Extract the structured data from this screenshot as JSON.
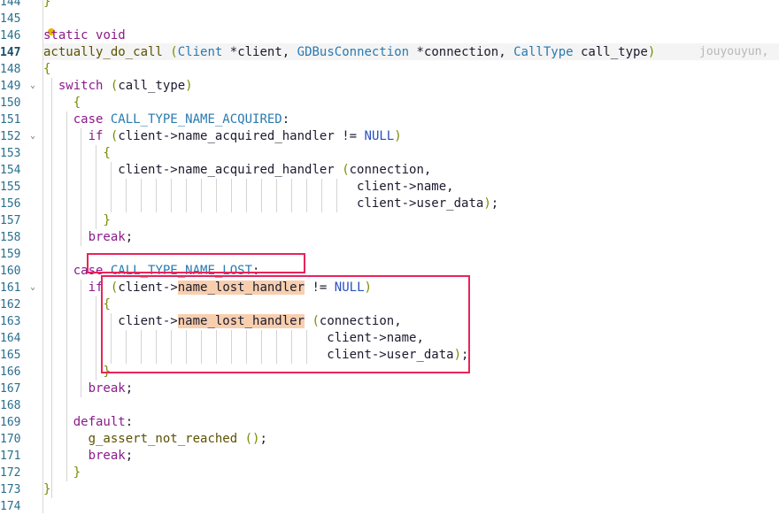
{
  "lines": [
    {
      "num": "144",
      "text": "}"
    },
    {
      "num": "145",
      "text": ""
    },
    {
      "num": "146",
      "text": "static void"
    },
    {
      "num": "147",
      "text": "actually_do_call (Client *client, GDBusConnection *connection, CallType call_type)"
    },
    {
      "num": "148",
      "text": "{"
    },
    {
      "num": "149",
      "text": "  switch (call_type)"
    },
    {
      "num": "150",
      "text": "    {"
    },
    {
      "num": "151",
      "text": "    case CALL_TYPE_NAME_ACQUIRED:"
    },
    {
      "num": "152",
      "text": "      if (client->name_acquired_handler != NULL)"
    },
    {
      "num": "153",
      "text": "        {"
    },
    {
      "num": "154",
      "text": "          client->name_acquired_handler (connection,"
    },
    {
      "num": "155",
      "text": "                                          client->name,"
    },
    {
      "num": "156",
      "text": "                                          client->user_data);"
    },
    {
      "num": "157",
      "text": "        }"
    },
    {
      "num": "158",
      "text": "      break;"
    },
    {
      "num": "159",
      "text": ""
    },
    {
      "num": "160",
      "text": "    case CALL_TYPE_NAME_LOST:"
    },
    {
      "num": "161",
      "text": "      if (client->name_lost_handler != NULL)"
    },
    {
      "num": "162",
      "text": "        {"
    },
    {
      "num": "163",
      "text": "          client->name_lost_handler (connection,"
    },
    {
      "num": "164",
      "text": "                                      client->name,"
    },
    {
      "num": "165",
      "text": "                                      client->user_data);"
    },
    {
      "num": "166",
      "text": "        }"
    },
    {
      "num": "167",
      "text": "      break;"
    },
    {
      "num": "168",
      "text": ""
    },
    {
      "num": "169",
      "text": "    default:"
    },
    {
      "num": "170",
      "text": "      g_assert_not_reached ();"
    },
    {
      "num": "171",
      "text": "      break;"
    },
    {
      "num": "172",
      "text": "    }"
    },
    {
      "num": "173",
      "text": "}"
    },
    {
      "num": "174",
      "text": ""
    }
  ],
  "blame": "jouyouyun,",
  "highlight_word": "name_lost_handler",
  "colors": {
    "keyword": "#8b1a8b",
    "type": "#2a7ab0",
    "line_number": "#2a6f8f",
    "highlight": "#f8cfae",
    "annotation": "#e8245a"
  }
}
